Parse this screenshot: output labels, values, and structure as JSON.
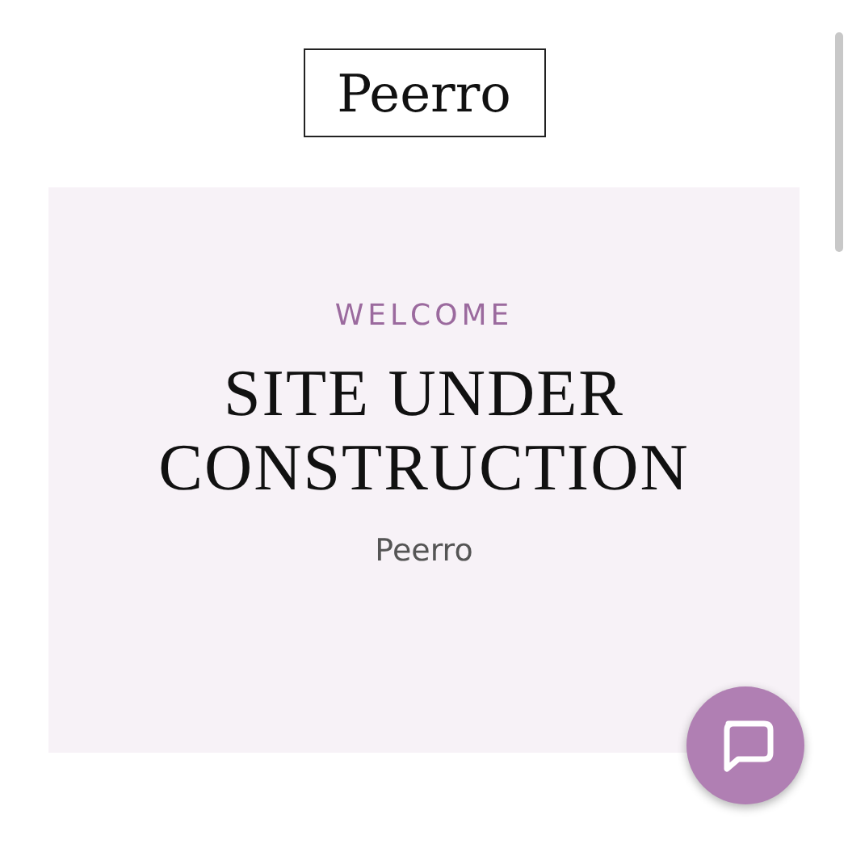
{
  "logo": {
    "text": "Peerro"
  },
  "hero": {
    "eyebrow": "WELCOME",
    "title_lines": [
      "SITE UNDER",
      "CONSTRUCTION"
    ],
    "subtitle": "Peerro"
  }
}
